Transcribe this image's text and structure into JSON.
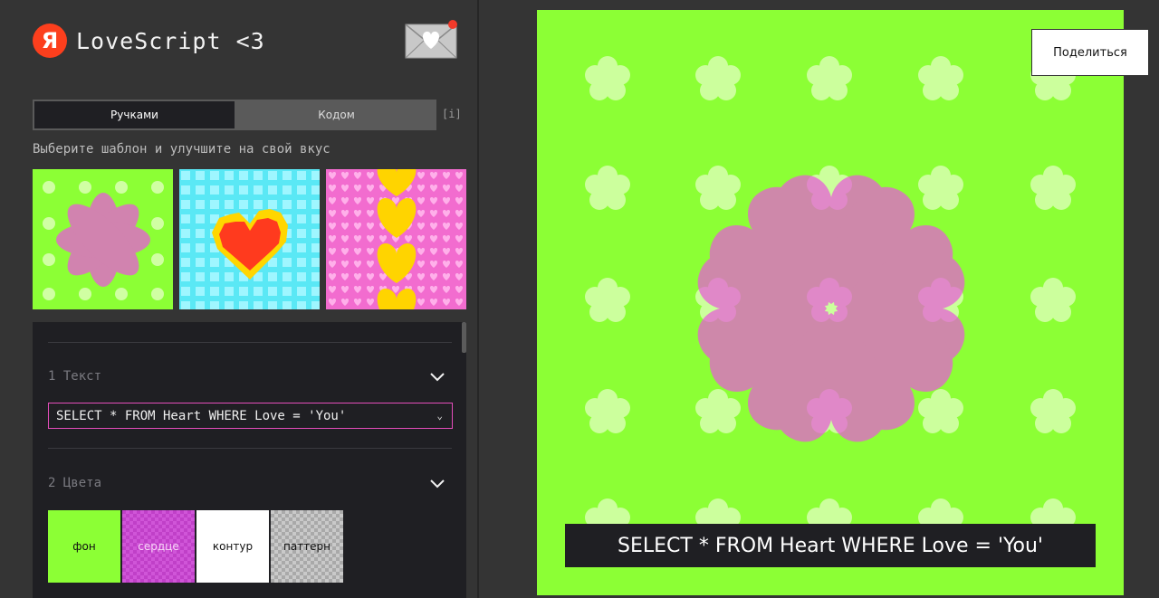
{
  "app": {
    "logo_letter": "Я",
    "title": "LoveScript <3"
  },
  "icons": {
    "logo": "yandex-logo",
    "mail": "envelope-heart-icon",
    "notification": "red-dot",
    "chevron": "chevron-down-icon"
  },
  "mode_tabs": [
    {
      "label": "Ручками",
      "active": true
    },
    {
      "label": "Кодом",
      "active": false
    }
  ],
  "info_label": "[i]",
  "hint": "Выберите шаблон и улучшите на свой вкус",
  "templates": [
    {
      "name": "green-flowers-pink-hearts",
      "bg": "#8cff35"
    },
    {
      "name": "blue-grid-red-heart",
      "bg": "#5ae8f5"
    },
    {
      "name": "pink-hearts-yellow-hearts",
      "bg": "#f26ccf"
    }
  ],
  "sections": {
    "text": {
      "title": "1 Текст",
      "selected_value": "SELECT * FROM Heart WHERE Love = 'You'"
    },
    "colors": {
      "title": "2 Цвета",
      "swatches": [
        {
          "label": "фон",
          "color": "#8cff35"
        },
        {
          "label": "сердце",
          "color": "#c040c8"
        },
        {
          "label": "контур",
          "color": "#ffffff"
        },
        {
          "label": "паттерн",
          "color": "#c9c9c9"
        }
      ]
    }
  },
  "preview": {
    "background": "#8cff35",
    "heart_color": "#e85ad8",
    "pattern_color": "#d8ffb0",
    "caption": "SELECT * FROM Heart WHERE Love = 'You'",
    "share_label": "Поделиться"
  }
}
